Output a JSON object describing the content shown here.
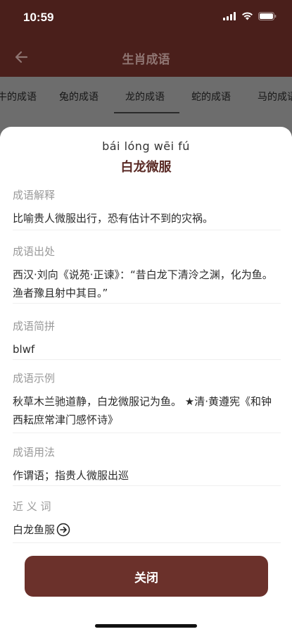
{
  "status": {
    "time": "10:59"
  },
  "nav": {
    "title": "生肖成语",
    "back_icon": "arrow-left-icon"
  },
  "tabs": [
    {
      "label": "牛的成语"
    },
    {
      "label": "兔的成语"
    },
    {
      "label": "龙的成语",
      "selected": true
    },
    {
      "label": "蛇的成语"
    },
    {
      "label": "马的成语"
    }
  ],
  "idiom": {
    "pinyin": "bái lóng wēi fú",
    "title": "白龙微服"
  },
  "sections": {
    "meaning": {
      "label": "成语解释",
      "text": "比喻贵人微服出行，恐有估计不到的灾祸。"
    },
    "source": {
      "label": "成语出处",
      "text": "西汉·刘向《说苑·正谏》：“昔白龙下清泠之渊，化为鱼。渔者豫且射中其目。”"
    },
    "abbr": {
      "label": "成语简拼",
      "text": "blwf"
    },
    "example": {
      "label": "成语示例",
      "text": "秋草木兰驰道静，白龙微服记为鱼。 ★清·黄遵宪《和钟西耘庶常津门感怀诗》"
    },
    "usage": {
      "label": "成语用法",
      "text": "作谓语；指贵人微服出巡"
    },
    "synonym": {
      "label": "近 义 词",
      "text": "白龙鱼服"
    }
  },
  "close_label": "关闭",
  "colors": {
    "header_bg": "#4a1f1b",
    "accent": "#6b312b",
    "dim": "#6d6d6d"
  }
}
